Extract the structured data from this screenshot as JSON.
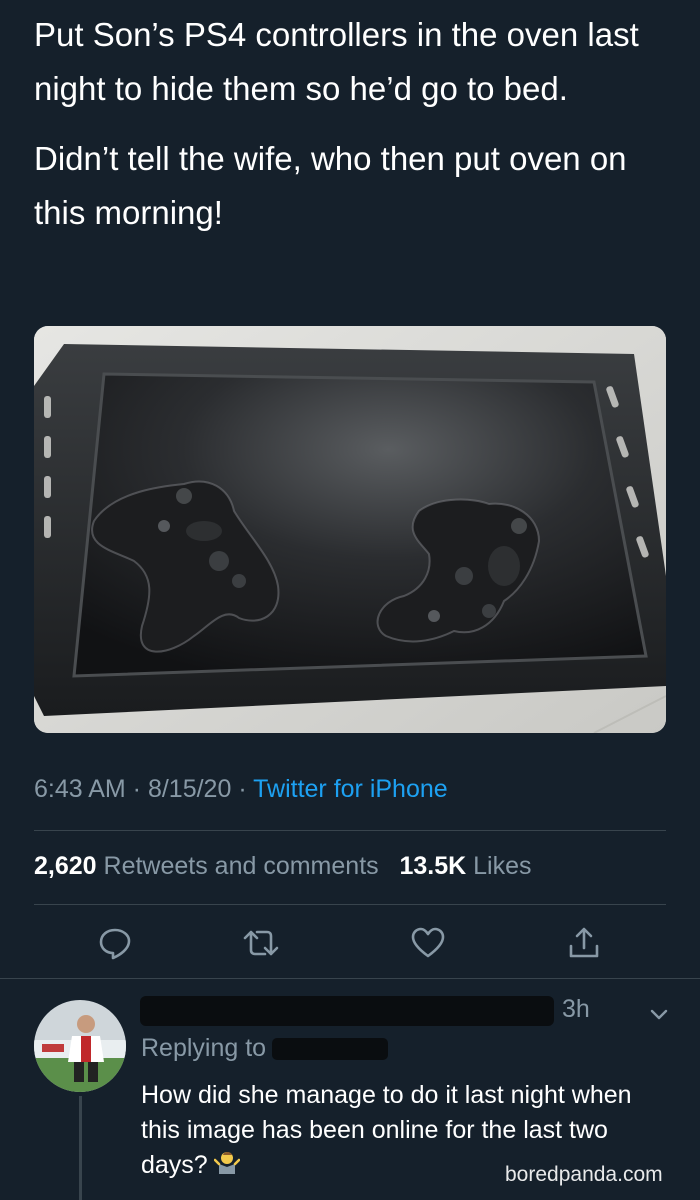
{
  "tweet": {
    "text_line1": "Put Son’s PS4 controllers in the oven last night to hide them so he’d go to bed.",
    "text_line2": "Didn’t tell the wife, who then put oven on this morning!",
    "time": "6:43 AM",
    "sep1": " · ",
    "date": "8/15/20",
    "sep2": " · ",
    "source": "Twitter for iPhone"
  },
  "stats": {
    "retweets_count": "2,620",
    "retweets_label": "Retweets and comments",
    "likes_count": "13.5K",
    "likes_label": "Likes"
  },
  "actions": [
    {
      "icon": "reply-icon"
    },
    {
      "icon": "retweet-icon"
    },
    {
      "icon": "like-icon"
    },
    {
      "icon": "share-icon"
    }
  ],
  "reply": {
    "time": "3h",
    "replying_label": "Replying to",
    "text": "How did she manage to do it last night when this image has been online for the last two days?",
    "emoji": "person-shrugging-emoji"
  },
  "watermark": "boredpanda.com",
  "colors": {
    "background": "#15202b",
    "text": "#ffffff",
    "secondary": "#8899a6",
    "accent": "#1da1f2",
    "divider": "#38444d"
  }
}
